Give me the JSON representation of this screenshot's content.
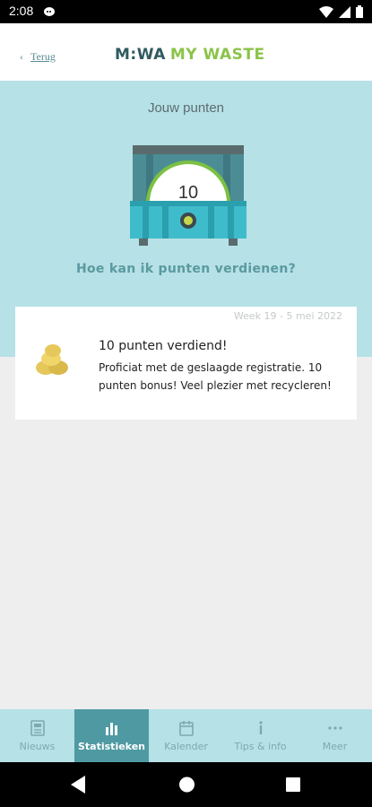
{
  "status": {
    "time": "2:08"
  },
  "header": {
    "back_label": "Terug",
    "logo_part1": "M:WA",
    "logo_part2": "MY WASTE"
  },
  "hero": {
    "title": "Jouw punten",
    "points": "10",
    "earn_link": "Hoe kan ik punten verdienen?"
  },
  "card": {
    "date": "Week 19 - 5 mei 2022",
    "title": "10 punten verdiend!",
    "body": "Proficiat met de geslaagde registratie. 10 punten bonus! Veel plezier met recycleren!"
  },
  "tabs": [
    {
      "label": "Nieuws",
      "icon": "news-icon"
    },
    {
      "label": "Statistieken",
      "icon": "bar-chart-icon"
    },
    {
      "label": "Kalender",
      "icon": "calendar-icon"
    },
    {
      "label": "Tips & info",
      "icon": "info-icon"
    },
    {
      "label": "Meer",
      "icon": "more-icon"
    }
  ],
  "active_tab": "Statistieken",
  "colors": {
    "accent": "#4f9aa2",
    "hero_bg": "#b6e1e6",
    "logo_green": "#8bc34a",
    "logo_dark": "#2f5a5f"
  }
}
